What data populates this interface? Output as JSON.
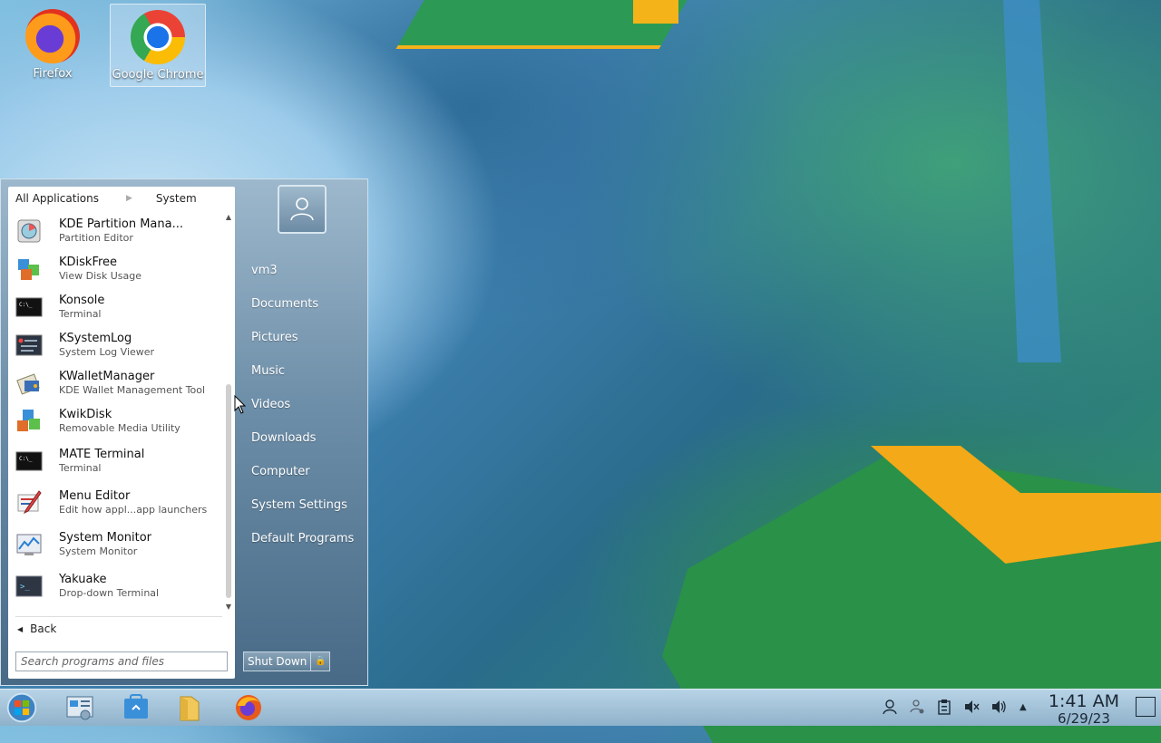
{
  "desktop": {
    "icons": [
      {
        "label": "Firefox"
      },
      {
        "label": "Google Chrome"
      }
    ]
  },
  "start_menu": {
    "breadcrumb": {
      "root": "All Applications",
      "current": "System"
    },
    "apps": [
      {
        "name": "KDE Partition Mana...",
        "desc": "Partition Editor",
        "icon": "partition-manager-icon"
      },
      {
        "name": "KDiskFree",
        "desc": "View Disk Usage",
        "icon": "kdiskfree-icon"
      },
      {
        "name": "Konsole",
        "desc": "Terminal",
        "icon": "terminal-icon"
      },
      {
        "name": "KSystemLog",
        "desc": "System Log Viewer",
        "icon": "system-log-icon"
      },
      {
        "name": "KWalletManager",
        "desc": "KDE Wallet Management Tool",
        "icon": "wallet-icon"
      },
      {
        "name": "KwikDisk",
        "desc": "Removable Media Utility",
        "icon": "kwikdisk-icon"
      },
      {
        "name": "MATE Terminal",
        "desc": "Terminal",
        "icon": "terminal-icon"
      },
      {
        "name": "Menu Editor",
        "desc": "Edit how appl...app launchers",
        "icon": "menu-editor-icon"
      },
      {
        "name": "System Monitor",
        "desc": "System Monitor",
        "icon": "system-monitor-icon"
      },
      {
        "name": "Yakuake",
        "desc": "Drop-down Terminal",
        "icon": "yakuake-icon"
      }
    ],
    "back_label": "Back",
    "search_placeholder": "Search programs and files",
    "places": [
      "vm3",
      "Documents",
      "Pictures",
      "Music",
      "Videos",
      "Downloads",
      "Computer",
      "System Settings",
      "Default Programs"
    ],
    "shutdown_label": "Shut Down"
  },
  "taskbar": {
    "time": "1:41 AM",
    "date": "6/29/23"
  }
}
